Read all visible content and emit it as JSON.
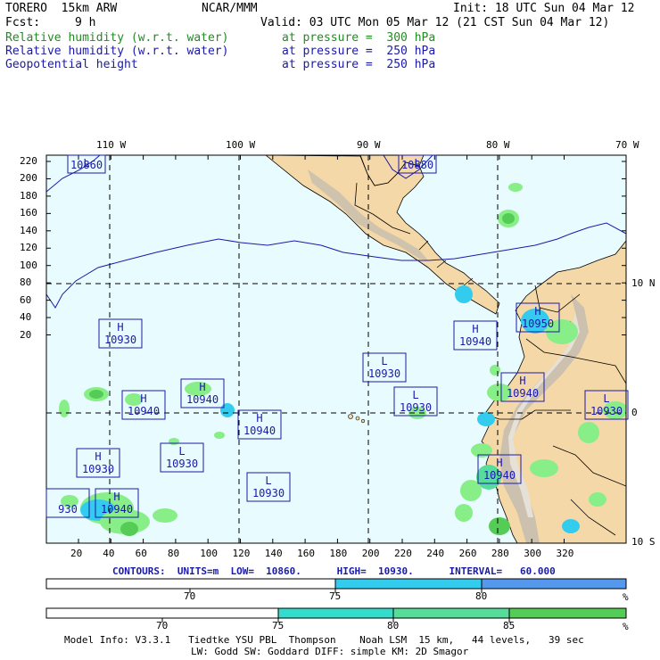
{
  "header": {
    "model_name": "TORERO  15km ARW",
    "org": "NCAR/MMM",
    "init": "Init: 18 UTC Sun 04 Mar 12",
    "fcst_label": "Fcst:",
    "fcst_value": "9 h",
    "valid": "Valid: 03 UTC Mon 05 Mar 12 (21 CST Sun 04 Mar 12)",
    "fields": [
      {
        "name": "Relative humidity (w.r.t. water)",
        "level": "at pressure =  300 hPa",
        "color": "#228b22"
      },
      {
        "name": "Relative humidity (w.r.t. water)",
        "level": "at pressure =  250 hPa",
        "color": "#1a1aaa"
      },
      {
        "name": "Geopotential height",
        "level": "at pressure =  250 hPa",
        "color": "#1a1aaa"
      }
    ]
  },
  "map": {
    "ocean_color": "#e8fcff",
    "land_color": "#f5d8a8",
    "lon_labels": [
      "110 W",
      "100 W",
      "90 W",
      "80 W",
      "70 W"
    ],
    "lat_labels": [
      "10 N",
      "0",
      "10 S"
    ],
    "y_ticks": [
      "220",
      "200",
      "180",
      "160",
      "140",
      "120",
      "100",
      "80",
      "60",
      "40",
      "20"
    ],
    "x_ticks": [
      "20",
      "40",
      "60",
      "80",
      "100",
      "120",
      "140",
      "160",
      "180",
      "200",
      "220",
      "240",
      "260",
      "280",
      "300",
      "320"
    ],
    "centers": [
      {
        "type": "H",
        "value": "10930"
      },
      {
        "type": "H",
        "value": "10940"
      },
      {
        "type": "H",
        "value": "10940"
      },
      {
        "type": "H",
        "value": "10940"
      },
      {
        "type": "H",
        "value": "10930"
      },
      {
        "type": "H",
        "value": "10940"
      },
      {
        "type": "H",
        "value": "10940"
      },
      {
        "type": "H",
        "value": "10950"
      },
      {
        "type": "H",
        "value": "10940"
      },
      {
        "type": "H",
        "value": "10940"
      },
      {
        "type": "L",
        "value": "10930"
      },
      {
        "type": "L",
        "value": "10930"
      },
      {
        "type": "L",
        "value": "10930"
      },
      {
        "type": "L",
        "value": "10930"
      },
      {
        "type": "L",
        "value": "10930"
      },
      {
        "type": "L",
        "value": "10860"
      },
      {
        "type": "L",
        "value": "10880"
      },
      {
        "type": "",
        "value": "930"
      }
    ]
  },
  "contours_info": "CONTOURS:  UNITS=m  LOW=  10860.      HIGH=  10930.      INTERVAL=   60.000",
  "colorbar1": {
    "labels": [
      "70",
      "75",
      "80"
    ],
    "unit": "%",
    "colors": [
      "#ffffff",
      "#33ccee",
      "#5599ee"
    ]
  },
  "colorbar2": {
    "labels": [
      "70",
      "75",
      "80",
      "85"
    ],
    "unit": "%",
    "colors": [
      "#ffffff",
      "#33ddcc",
      "#55dd99",
      "#88ee88",
      "#55cc55"
    ]
  },
  "footer": {
    "line1": "Model Info: V3.3.1   Tiedtke YSU PBL  Thompson    Noah LSM  15 km,   44 levels,   39 sec",
    "line2": "LW: Godd SW: Goddard DIFF: simple KM: 2D Smagor"
  }
}
